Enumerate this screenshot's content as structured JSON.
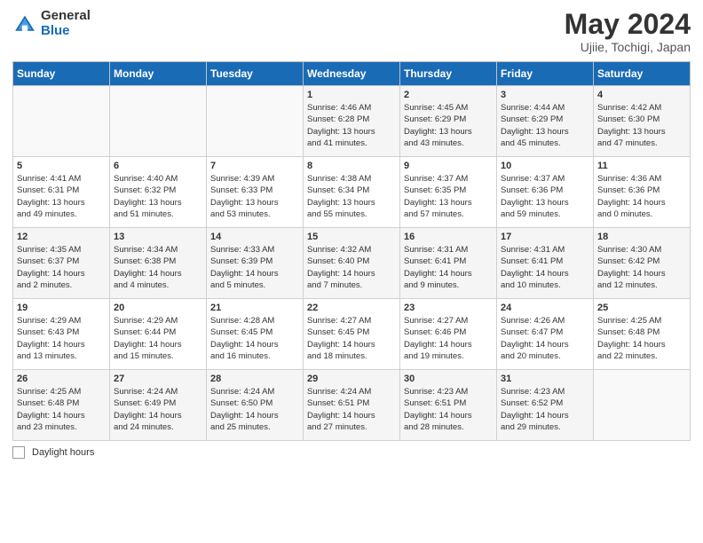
{
  "header": {
    "logo_general": "General",
    "logo_blue": "Blue",
    "main_title": "May 2024",
    "subtitle": "Ujiie, Tochigi, Japan"
  },
  "weekdays": [
    "Sunday",
    "Monday",
    "Tuesday",
    "Wednesday",
    "Thursday",
    "Friday",
    "Saturday"
  ],
  "weeks": [
    [
      {
        "day": "",
        "info": ""
      },
      {
        "day": "",
        "info": ""
      },
      {
        "day": "",
        "info": ""
      },
      {
        "day": "1",
        "info": "Sunrise: 4:46 AM\nSunset: 6:28 PM\nDaylight: 13 hours\nand 41 minutes."
      },
      {
        "day": "2",
        "info": "Sunrise: 4:45 AM\nSunset: 6:29 PM\nDaylight: 13 hours\nand 43 minutes."
      },
      {
        "day": "3",
        "info": "Sunrise: 4:44 AM\nSunset: 6:29 PM\nDaylight: 13 hours\nand 45 minutes."
      },
      {
        "day": "4",
        "info": "Sunrise: 4:42 AM\nSunset: 6:30 PM\nDaylight: 13 hours\nand 47 minutes."
      }
    ],
    [
      {
        "day": "5",
        "info": "Sunrise: 4:41 AM\nSunset: 6:31 PM\nDaylight: 13 hours\nand 49 minutes."
      },
      {
        "day": "6",
        "info": "Sunrise: 4:40 AM\nSunset: 6:32 PM\nDaylight: 13 hours\nand 51 minutes."
      },
      {
        "day": "7",
        "info": "Sunrise: 4:39 AM\nSunset: 6:33 PM\nDaylight: 13 hours\nand 53 minutes."
      },
      {
        "day": "8",
        "info": "Sunrise: 4:38 AM\nSunset: 6:34 PM\nDaylight: 13 hours\nand 55 minutes."
      },
      {
        "day": "9",
        "info": "Sunrise: 4:37 AM\nSunset: 6:35 PM\nDaylight: 13 hours\nand 57 minutes."
      },
      {
        "day": "10",
        "info": "Sunrise: 4:37 AM\nSunset: 6:36 PM\nDaylight: 13 hours\nand 59 minutes."
      },
      {
        "day": "11",
        "info": "Sunrise: 4:36 AM\nSunset: 6:36 PM\nDaylight: 14 hours\nand 0 minutes."
      }
    ],
    [
      {
        "day": "12",
        "info": "Sunrise: 4:35 AM\nSunset: 6:37 PM\nDaylight: 14 hours\nand 2 minutes."
      },
      {
        "day": "13",
        "info": "Sunrise: 4:34 AM\nSunset: 6:38 PM\nDaylight: 14 hours\nand 4 minutes."
      },
      {
        "day": "14",
        "info": "Sunrise: 4:33 AM\nSunset: 6:39 PM\nDaylight: 14 hours\nand 5 minutes."
      },
      {
        "day": "15",
        "info": "Sunrise: 4:32 AM\nSunset: 6:40 PM\nDaylight: 14 hours\nand 7 minutes."
      },
      {
        "day": "16",
        "info": "Sunrise: 4:31 AM\nSunset: 6:41 PM\nDaylight: 14 hours\nand 9 minutes."
      },
      {
        "day": "17",
        "info": "Sunrise: 4:31 AM\nSunset: 6:41 PM\nDaylight: 14 hours\nand 10 minutes."
      },
      {
        "day": "18",
        "info": "Sunrise: 4:30 AM\nSunset: 6:42 PM\nDaylight: 14 hours\nand 12 minutes."
      }
    ],
    [
      {
        "day": "19",
        "info": "Sunrise: 4:29 AM\nSunset: 6:43 PM\nDaylight: 14 hours\nand 13 minutes."
      },
      {
        "day": "20",
        "info": "Sunrise: 4:29 AM\nSunset: 6:44 PM\nDaylight: 14 hours\nand 15 minutes."
      },
      {
        "day": "21",
        "info": "Sunrise: 4:28 AM\nSunset: 6:45 PM\nDaylight: 14 hours\nand 16 minutes."
      },
      {
        "day": "22",
        "info": "Sunrise: 4:27 AM\nSunset: 6:45 PM\nDaylight: 14 hours\nand 18 minutes."
      },
      {
        "day": "23",
        "info": "Sunrise: 4:27 AM\nSunset: 6:46 PM\nDaylight: 14 hours\nand 19 minutes."
      },
      {
        "day": "24",
        "info": "Sunrise: 4:26 AM\nSunset: 6:47 PM\nDaylight: 14 hours\nand 20 minutes."
      },
      {
        "day": "25",
        "info": "Sunrise: 4:25 AM\nSunset: 6:48 PM\nDaylight: 14 hours\nand 22 minutes."
      }
    ],
    [
      {
        "day": "26",
        "info": "Sunrise: 4:25 AM\nSunset: 6:48 PM\nDaylight: 14 hours\nand 23 minutes."
      },
      {
        "day": "27",
        "info": "Sunrise: 4:24 AM\nSunset: 6:49 PM\nDaylight: 14 hours\nand 24 minutes."
      },
      {
        "day": "28",
        "info": "Sunrise: 4:24 AM\nSunset: 6:50 PM\nDaylight: 14 hours\nand 25 minutes."
      },
      {
        "day": "29",
        "info": "Sunrise: 4:24 AM\nSunset: 6:51 PM\nDaylight: 14 hours\nand 27 minutes."
      },
      {
        "day": "30",
        "info": "Sunrise: 4:23 AM\nSunset: 6:51 PM\nDaylight: 14 hours\nand 28 minutes."
      },
      {
        "day": "31",
        "info": "Sunrise: 4:23 AM\nSunset: 6:52 PM\nDaylight: 14 hours\nand 29 minutes."
      },
      {
        "day": "",
        "info": ""
      }
    ]
  ],
  "footer": {
    "legend_label": "Daylight hours"
  }
}
